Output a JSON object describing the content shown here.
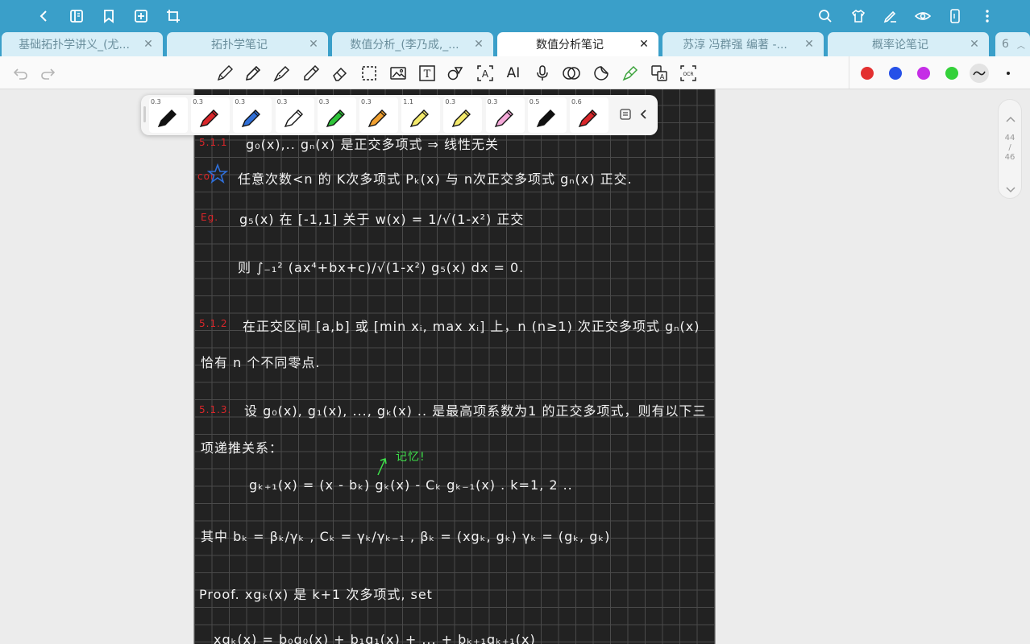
{
  "top_bar": {
    "icons": [
      "back-arrow-icon",
      "notebook-icon",
      "bookmark-icon",
      "add-page-icon",
      "crop-icon",
      "search-icon",
      "shirt-icon",
      "pen-edit-icon",
      "eye-icon",
      "phone-icon",
      "more-vertical-icon"
    ]
  },
  "tabs": [
    {
      "label": "基础拓扑学讲义_(尤...",
      "active": false
    },
    {
      "label": "拓扑学笔记",
      "active": false
    },
    {
      "label": "数值分析_(李乃成,_...",
      "active": false
    },
    {
      "label": "数值分析笔记",
      "active": true
    },
    {
      "label": "苏淳 冯群强 编著 -...",
      "active": false
    },
    {
      "label": "概率论笔记",
      "active": false
    },
    {
      "label": "6",
      "active": false
    }
  ],
  "toolbar": {
    "tools": [
      "pencil-icon",
      "pen-icon",
      "fountain-pen-icon",
      "highlighter-icon",
      "eraser-icon",
      "lasso-select-icon",
      "image-icon",
      "text-box-icon",
      "shapes-icon",
      "text-recognition-icon",
      "ai-icon",
      "microphone-icon",
      "link-icon",
      "sticker-icon",
      "laser-pointer-icon",
      "translate-icon",
      "ocr-icon"
    ],
    "ai_label": "AI",
    "ocr_label": "OCR",
    "text_label": "T",
    "colors": [
      "#e33030",
      "#2651e8",
      "#c52ee6",
      "#34d13a"
    ]
  },
  "pen_presets": [
    {
      "width": "0.3",
      "color": "#111111"
    },
    {
      "width": "0.3",
      "color": "#d9262a"
    },
    {
      "width": "0.3",
      "color": "#2f6fd8"
    },
    {
      "width": "0.3",
      "color": "#ffffff"
    },
    {
      "width": "0.3",
      "color": "#2fc43a"
    },
    {
      "width": "0.3",
      "color": "#f0a030"
    },
    {
      "width": "1.1",
      "color": "#f4ea6c"
    },
    {
      "width": "0.3",
      "color": "#f4ea6c"
    },
    {
      "width": "0.3",
      "color": "#f4a8d8"
    },
    {
      "width": "0.5",
      "color": "#111111"
    },
    {
      "width": "0.6",
      "color": "#d9262a"
    }
  ],
  "page_indicator": {
    "current": "44",
    "sep": "/",
    "total": "46"
  },
  "note": {
    "line1_num": "5.1.1",
    "line1": "g₀(x),..  gₙ(x) 是正交多项式  ⇒  线性无关",
    "line2_num": "cor",
    "line2": "任意次数<n 的 K次多项式 Pₖ(x) 与 n次正交多项式 gₙ(x) 正交.",
    "line3_num": "Eg.",
    "line3": "g₅(x) 在 [-1,1] 关于 w(x) = 1/√(1-x²) 正交",
    "line4": "则  ∫₋₁² (ax⁴+bx+c)/√(1-x²) g₅(x) dx = 0.",
    "line5_num": "5.1.2",
    "line5": "在正交区间 [a,b] 或 [min xᵢ, max xᵢ] 上，n (n≥1) 次正交多项式 gₙ(x)",
    "line6": "恰有 n 个不同零点.",
    "line7_num": "5.1.3.",
    "line7": "设 g₀(x), g₁(x), ..., gₖ(x) .. 是最高项系数为1 的正交多项式，则有以下三",
    "line8": "项递推关系：",
    "arrow_note": "记忆!",
    "line9": "gₖ₊₁(x) = (x - bₖ) gₖ(x) - Cₖ gₖ₋₁(x)  .   k=1, 2 ..",
    "line10": "其中  bₖ = βₖ/γₖ ,  Cₖ = γₖ/γₖ₋₁ ,  βₖ = (xgₖ, gₖ)      γₖ = (gₖ, gₖ)",
    "line11": "Proof.  xgₖ(x) 是 k+1 次多项式,    set",
    "line12": "xgₖ(x) = b₀g₀(x) + b₁g₁(x) + ... + bₖ₊₁gₖ₊₁(x)"
  }
}
